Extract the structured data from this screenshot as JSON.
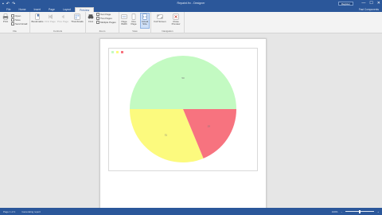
{
  "window": {
    "title": "Repaint.frx - Designer",
    "account_label": "Register",
    "controls": {
      "minimize": "—",
      "maximize": "☐",
      "close": "✕"
    }
  },
  "tabs": [
    {
      "label": "File"
    },
    {
      "label": "Home"
    },
    {
      "label": "Insert"
    },
    {
      "label": "Page"
    },
    {
      "label": "Layout"
    },
    {
      "label": "Preview"
    }
  ],
  "user_label": "Fast Components",
  "ribbon": {
    "print": {
      "label": "Print"
    },
    "checks": [
      {
        "label": "Open"
      },
      {
        "label": "Save"
      },
      {
        "label": "Send Email"
      }
    ],
    "export": {
      "bookmarks": "Bookmarks",
      "first": "First Page",
      "prev": "Prev Page",
      "thumbnails": "Thumbnails"
    },
    "find": {
      "label": "Find"
    },
    "view_checks": [
      {
        "label": "Text Page"
      },
      {
        "label": "Two Pages"
      },
      {
        "label": "Multiple Pages"
      }
    ],
    "zoom": {
      "page_width": "Page Width",
      "one_page": "One Page",
      "actual": "Actual Size",
      "fullscreen": "Full Screen",
      "close": "Close Preview"
    },
    "groups": [
      "File",
      "Controls",
      "Zoom",
      "View",
      "Navigation"
    ]
  },
  "chart_data": {
    "type": "pie",
    "title": "",
    "legend": [
      "",
      "",
      ""
    ],
    "slices": [
      {
        "name": "",
        "value": 50,
        "color": "#c3fac2"
      },
      {
        "name": "",
        "value": 31.25,
        "color": "#fcfa7e"
      },
      {
        "name": "",
        "value": 18.75,
        "color": "#f7737f"
      }
    ],
    "start_angle_deg": 0,
    "data_labels": [
      "50",
      "31",
      "19"
    ]
  },
  "status": {
    "page": "Page 1 of 1",
    "info": "Generating report",
    "zoom": "100%"
  },
  "colors": {
    "accent": "#2b579a",
    "ribbon_bg": "#f3f3f3",
    "workspace_bg": "#e6e6e6"
  }
}
